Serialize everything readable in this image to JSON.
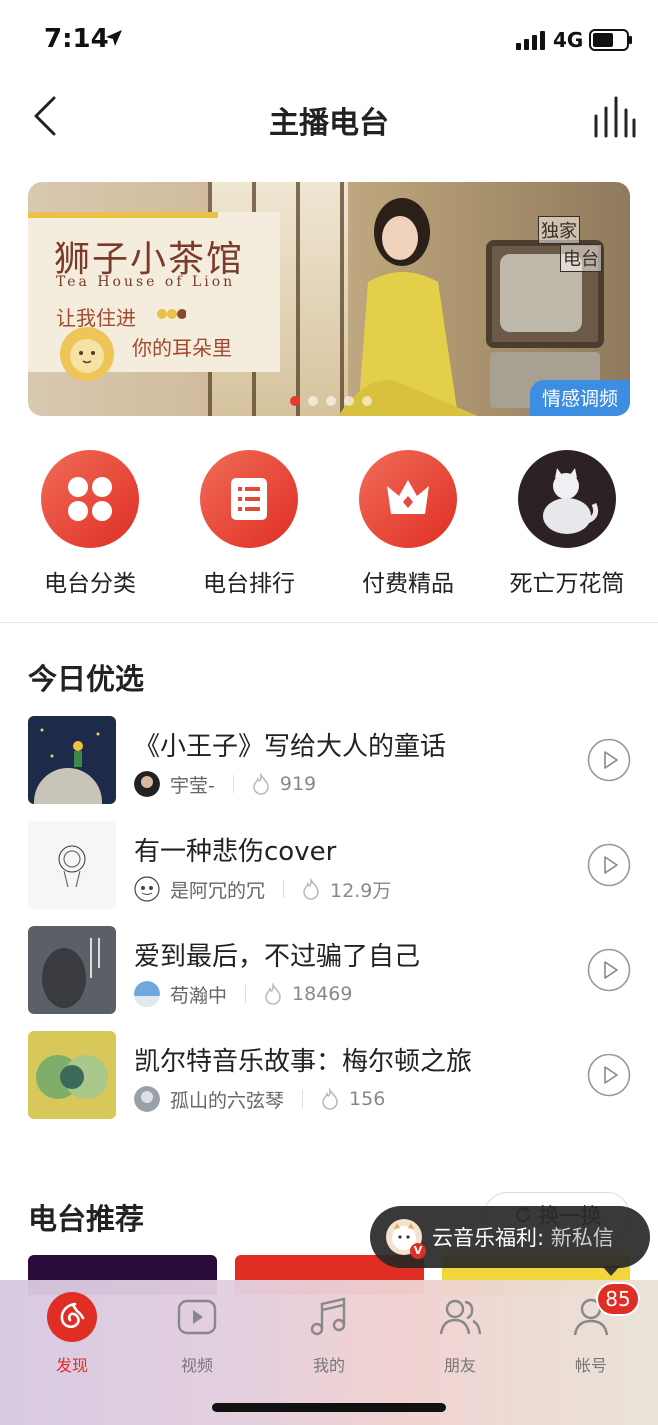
{
  "status_bar": {
    "time": "7:14",
    "network": "4G"
  },
  "nav": {
    "title": "主播电台"
  },
  "banner": {
    "title_cn": "狮子小茶馆",
    "title_en": "Tea House of Lion",
    "line1": "让我住进",
    "line2": "你的耳朵里",
    "badge_top": "独家",
    "badge_bottom": "电台",
    "tag": "情感调频",
    "page_count": 5,
    "active_page": 1
  },
  "quick_links": [
    {
      "label": "电台分类",
      "icon": "clover-icon"
    },
    {
      "label": "电台排行",
      "icon": "list-icon"
    },
    {
      "label": "付费精品",
      "icon": "crown-icon"
    },
    {
      "label": "死亡万花筒",
      "icon": "cat-avatar-icon"
    }
  ],
  "today_section": {
    "title": "今日优选",
    "items": [
      {
        "title": "《小王子》写给大人的童话",
        "author": "宇莹-",
        "count": "919"
      },
      {
        "title": "有一种悲伤cover",
        "author": "是阿冗的冗",
        "count": "12.9万"
      },
      {
        "title": "爱到最后，不过骗了自己",
        "author": "苟瀚中",
        "count": "18469"
      },
      {
        "title": "凯尔特音乐故事：梅尔顿之旅",
        "author": "孤山的六弦琴",
        "count": "156"
      }
    ]
  },
  "recommend_section": {
    "title": "电台推荐",
    "refresh_label": "换一换"
  },
  "toast": {
    "text_main": "云音乐福利",
    "text_sub": "新私信"
  },
  "tabbar": {
    "tabs": [
      {
        "label": "发现",
        "icon": "discover-icon"
      },
      {
        "label": "视频",
        "icon": "video-icon"
      },
      {
        "label": "我的",
        "icon": "music-note-icon"
      },
      {
        "label": "朋友",
        "icon": "friends-icon"
      },
      {
        "label": "帐号",
        "icon": "account-icon"
      }
    ],
    "badge": "85"
  },
  "colors": {
    "accent": "#e02e24",
    "tag_blue": "#3d8ee0"
  }
}
